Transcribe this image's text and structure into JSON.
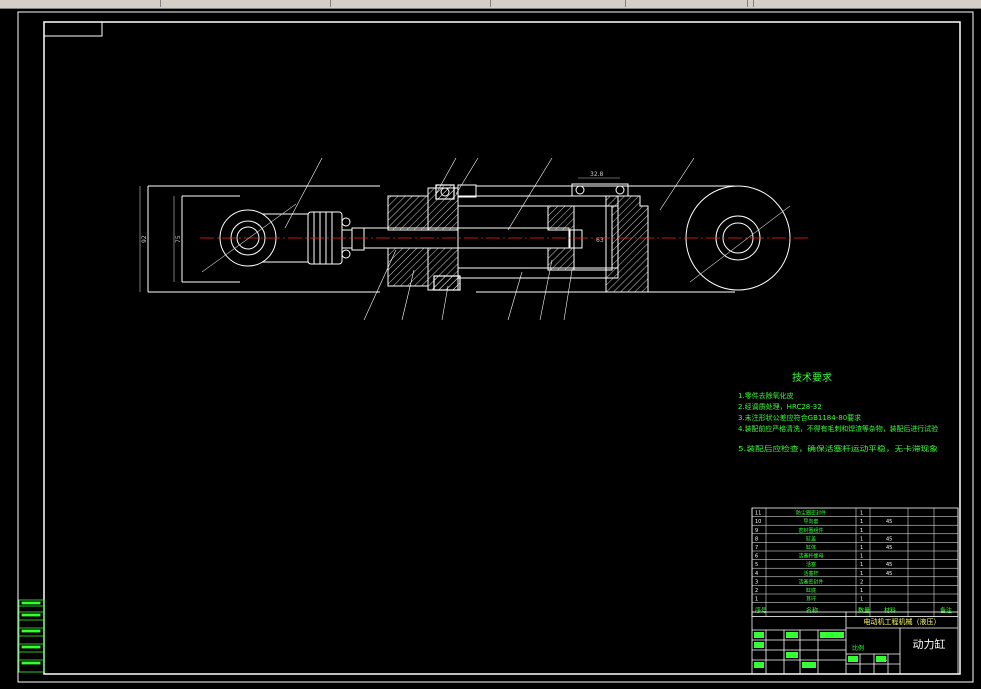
{
  "window": {
    "toolbar_segments": 7
  },
  "colors": {
    "background": "#000000",
    "line_white": "#ffffff",
    "centerline": "#ff2020",
    "dimension": "#c8c8c8",
    "notes_green": "#33ff33",
    "table_green": "#33ff33",
    "title_yellow": "#ffff66"
  },
  "drawing": {
    "dimensions": {
      "top_width": "32.8",
      "height_total": "92",
      "height_inner": "75",
      "bore": "63"
    }
  },
  "tech_notes": {
    "title": "技术要求",
    "lines": [
      "1.零件去除氧化皮",
      "2.经调质处理，HRC28-32",
      "3.未注形状公差应符合GB1184-80要求",
      "4.装配前应严格清洗，不得有毛刺和焊渣等杂物，装配后进行试验",
      "5.装配后应检查，确保活塞杆运动平稳，无卡滞现象"
    ]
  },
  "parts_table": {
    "rows": [
      {
        "no": "11",
        "name": "防尘圈密封件",
        "qty": "1",
        "material": ""
      },
      {
        "no": "10",
        "name": "导向套",
        "qty": "1",
        "material": "45"
      },
      {
        "no": "9",
        "name": "密封圈组件",
        "qty": "1",
        "material": ""
      },
      {
        "no": "8",
        "name": "缸盖",
        "qty": "1",
        "material": "45"
      },
      {
        "no": "7",
        "name": "缸体",
        "qty": "1",
        "material": "45"
      },
      {
        "no": "6",
        "name": "活塞杆螺母",
        "qty": "1",
        "material": ""
      },
      {
        "no": "5",
        "name": "活塞",
        "qty": "1",
        "material": "45"
      },
      {
        "no": "4",
        "name": "活塞杆",
        "qty": "1",
        "material": "45"
      },
      {
        "no": "3",
        "name": "活塞密封件",
        "qty": "2",
        "material": ""
      },
      {
        "no": "2",
        "name": "缸底",
        "qty": "1",
        "material": ""
      },
      {
        "no": "1",
        "name": "耳环",
        "qty": "1",
        "material": ""
      }
    ],
    "header": {
      "no": "序号",
      "name": "名称",
      "qty": "数量",
      "material": "材料",
      "note": "备注"
    }
  },
  "title_block": {
    "project": "电动机工程机械（液压）",
    "drawing_name": "动力缸",
    "scale_label": "比例",
    "scale": "1:1",
    "sheet_labels": [
      "共",
      "张",
      "第",
      "张"
    ]
  }
}
